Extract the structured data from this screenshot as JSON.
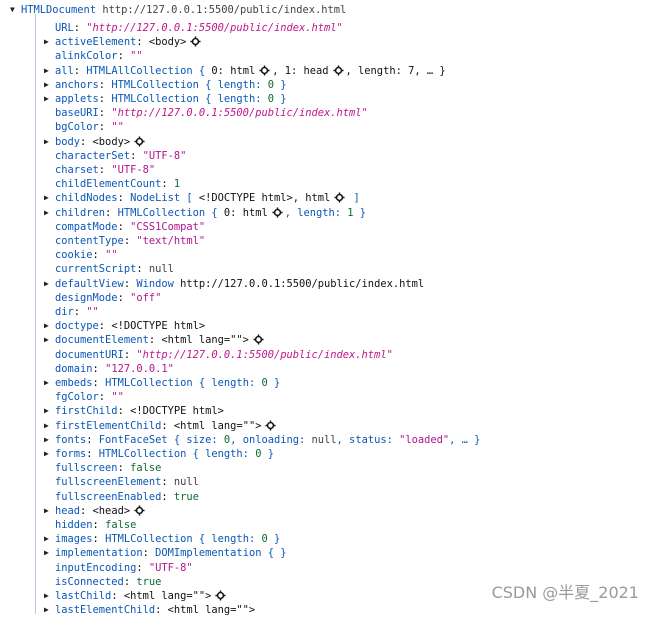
{
  "header": {
    "object": "HTMLDocument",
    "location": "http://127.0.0.1:5500/public/index.html"
  },
  "rows": [
    {
      "expandable": false,
      "key": "URL",
      "parts": [
        {
          "t": "\"http://127.0.0.1:5500/public/index.html\"",
          "c": "url"
        }
      ]
    },
    {
      "expandable": true,
      "key": "activeElement",
      "parts": [
        {
          "t": "<body>",
          "c": "plain"
        },
        {
          "icon": true
        }
      ]
    },
    {
      "expandable": false,
      "key": "alinkColor",
      "parts": [
        {
          "t": "\"\"",
          "c": "str"
        }
      ]
    },
    {
      "expandable": true,
      "key": "all",
      "parts": [
        {
          "t": "HTMLAllCollection { ",
          "c": "obj"
        },
        {
          "t": "0: html",
          "c": "plain"
        },
        {
          "icon": true
        },
        {
          "t": ", 1: head",
          "c": "plain"
        },
        {
          "icon": true
        },
        {
          "t": ", length: 7, … }",
          "c": "plain"
        }
      ]
    },
    {
      "expandable": true,
      "key": "anchors",
      "parts": [
        {
          "t": "HTMLCollection { length: ",
          "c": "obj"
        },
        {
          "t": "0",
          "c": "num"
        },
        {
          "t": " }",
          "c": "obj"
        }
      ]
    },
    {
      "expandable": true,
      "key": "applets",
      "parts": [
        {
          "t": "HTMLCollection { length: ",
          "c": "obj"
        },
        {
          "t": "0",
          "c": "num"
        },
        {
          "t": " }",
          "c": "obj"
        }
      ]
    },
    {
      "expandable": false,
      "key": "baseURI",
      "parts": [
        {
          "t": "\"http://127.0.0.1:5500/public/index.html\"",
          "c": "url"
        }
      ]
    },
    {
      "expandable": false,
      "key": "bgColor",
      "parts": [
        {
          "t": "\"\"",
          "c": "str"
        }
      ]
    },
    {
      "expandable": true,
      "key": "body",
      "parts": [
        {
          "t": "<body>",
          "c": "plain"
        },
        {
          "icon": true
        }
      ]
    },
    {
      "expandable": false,
      "key": "characterSet",
      "parts": [
        {
          "t": "\"UTF-8\"",
          "c": "str"
        }
      ]
    },
    {
      "expandable": false,
      "key": "charset",
      "parts": [
        {
          "t": "\"UTF-8\"",
          "c": "str"
        }
      ]
    },
    {
      "expandable": false,
      "key": "childElementCount",
      "parts": [
        {
          "t": "1",
          "c": "num"
        }
      ]
    },
    {
      "expandable": true,
      "key": "childNodes",
      "parts": [
        {
          "t": "NodeList [ ",
          "c": "obj"
        },
        {
          "t": "<!DOCTYPE html>, html",
          "c": "plain"
        },
        {
          "icon": true
        },
        {
          "t": " ]",
          "c": "obj"
        }
      ]
    },
    {
      "expandable": true,
      "key": "children",
      "parts": [
        {
          "t": "HTMLCollection { ",
          "c": "obj"
        },
        {
          "t": "0: html",
          "c": "plain"
        },
        {
          "icon": true
        },
        {
          "t": ", length: ",
          "c": "obj"
        },
        {
          "t": "1",
          "c": "num"
        },
        {
          "t": " }",
          "c": "obj"
        }
      ]
    },
    {
      "expandable": false,
      "key": "compatMode",
      "parts": [
        {
          "t": "\"CSS1Compat\"",
          "c": "str"
        }
      ]
    },
    {
      "expandable": false,
      "key": "contentType",
      "parts": [
        {
          "t": "\"text/html\"",
          "c": "str"
        }
      ]
    },
    {
      "expandable": false,
      "key": "cookie",
      "parts": [
        {
          "t": "\"\"",
          "c": "str"
        }
      ]
    },
    {
      "expandable": false,
      "key": "currentScript",
      "parts": [
        {
          "t": "null",
          "c": "nul"
        }
      ]
    },
    {
      "expandable": true,
      "key": "defaultView",
      "parts": [
        {
          "t": "Window ",
          "c": "obj"
        },
        {
          "t": "http://127.0.0.1:5500/public/index.html",
          "c": "plain"
        }
      ]
    },
    {
      "expandable": false,
      "key": "designMode",
      "parts": [
        {
          "t": "\"off\"",
          "c": "str"
        }
      ]
    },
    {
      "expandable": false,
      "key": "dir",
      "parts": [
        {
          "t": "\"\"",
          "c": "str"
        }
      ]
    },
    {
      "expandable": true,
      "key": "doctype",
      "parts": [
        {
          "t": "<!DOCTYPE html>",
          "c": "plain"
        }
      ]
    },
    {
      "expandable": true,
      "key": "documentElement",
      "parts": [
        {
          "t": "<html lang=\"\">",
          "c": "plain"
        },
        {
          "icon": true
        }
      ]
    },
    {
      "expandable": false,
      "key": "documentURI",
      "parts": [
        {
          "t": "\"http://127.0.0.1:5500/public/index.html\"",
          "c": "url"
        }
      ]
    },
    {
      "expandable": false,
      "key": "domain",
      "parts": [
        {
          "t": "\"127.0.0.1\"",
          "c": "str"
        }
      ]
    },
    {
      "expandable": true,
      "key": "embeds",
      "parts": [
        {
          "t": "HTMLCollection { length: ",
          "c": "obj"
        },
        {
          "t": "0",
          "c": "num"
        },
        {
          "t": " }",
          "c": "obj"
        }
      ]
    },
    {
      "expandable": false,
      "key": "fgColor",
      "parts": [
        {
          "t": "\"\"",
          "c": "str"
        }
      ]
    },
    {
      "expandable": true,
      "key": "firstChild",
      "parts": [
        {
          "t": "<!DOCTYPE html>",
          "c": "plain"
        }
      ]
    },
    {
      "expandable": true,
      "key": "firstElementChild",
      "parts": [
        {
          "t": "<html lang=\"\">",
          "c": "plain"
        },
        {
          "icon": true
        }
      ]
    },
    {
      "expandable": true,
      "key": "fonts",
      "parts": [
        {
          "t": "FontFaceSet { size: ",
          "c": "obj"
        },
        {
          "t": "0",
          "c": "num"
        },
        {
          "t": ", onloading: ",
          "c": "obj"
        },
        {
          "t": "null",
          "c": "nul"
        },
        {
          "t": ", status: ",
          "c": "obj"
        },
        {
          "t": "\"loaded\"",
          "c": "str"
        },
        {
          "t": ", … }",
          "c": "obj"
        }
      ]
    },
    {
      "expandable": true,
      "key": "forms",
      "parts": [
        {
          "t": "HTMLCollection { length: ",
          "c": "obj"
        },
        {
          "t": "0",
          "c": "num"
        },
        {
          "t": " }",
          "c": "obj"
        }
      ]
    },
    {
      "expandable": false,
      "key": "fullscreen",
      "parts": [
        {
          "t": "false",
          "c": "bool"
        }
      ]
    },
    {
      "expandable": false,
      "key": "fullscreenElement",
      "parts": [
        {
          "t": "null",
          "c": "nul"
        }
      ]
    },
    {
      "expandable": false,
      "key": "fullscreenEnabled",
      "parts": [
        {
          "t": "true",
          "c": "bool"
        }
      ]
    },
    {
      "expandable": true,
      "key": "head",
      "parts": [
        {
          "t": "<head>",
          "c": "plain"
        },
        {
          "icon": true
        }
      ]
    },
    {
      "expandable": false,
      "key": "hidden",
      "parts": [
        {
          "t": "false",
          "c": "bool"
        }
      ]
    },
    {
      "expandable": true,
      "key": "images",
      "parts": [
        {
          "t": "HTMLCollection { length: ",
          "c": "obj"
        },
        {
          "t": "0",
          "c": "num"
        },
        {
          "t": " }",
          "c": "obj"
        }
      ]
    },
    {
      "expandable": true,
      "key": "implementation",
      "parts": [
        {
          "t": "DOMImplementation {  }",
          "c": "obj"
        }
      ]
    },
    {
      "expandable": false,
      "key": "inputEncoding",
      "parts": [
        {
          "t": "\"UTF-8\"",
          "c": "str"
        }
      ]
    },
    {
      "expandable": false,
      "key": "isConnected",
      "parts": [
        {
          "t": "true",
          "c": "bool"
        }
      ]
    },
    {
      "expandable": true,
      "key": "lastChild",
      "parts": [
        {
          "t": "<html lang=\"\">",
          "c": "plain"
        },
        {
          "icon": true
        }
      ]
    },
    {
      "expandable": true,
      "key": "lastElementChild",
      "parts": [
        {
          "t": "<html lang=\"\">",
          "c": "plain"
        }
      ]
    }
  ],
  "watermark": "CSDN @半夏_2021"
}
